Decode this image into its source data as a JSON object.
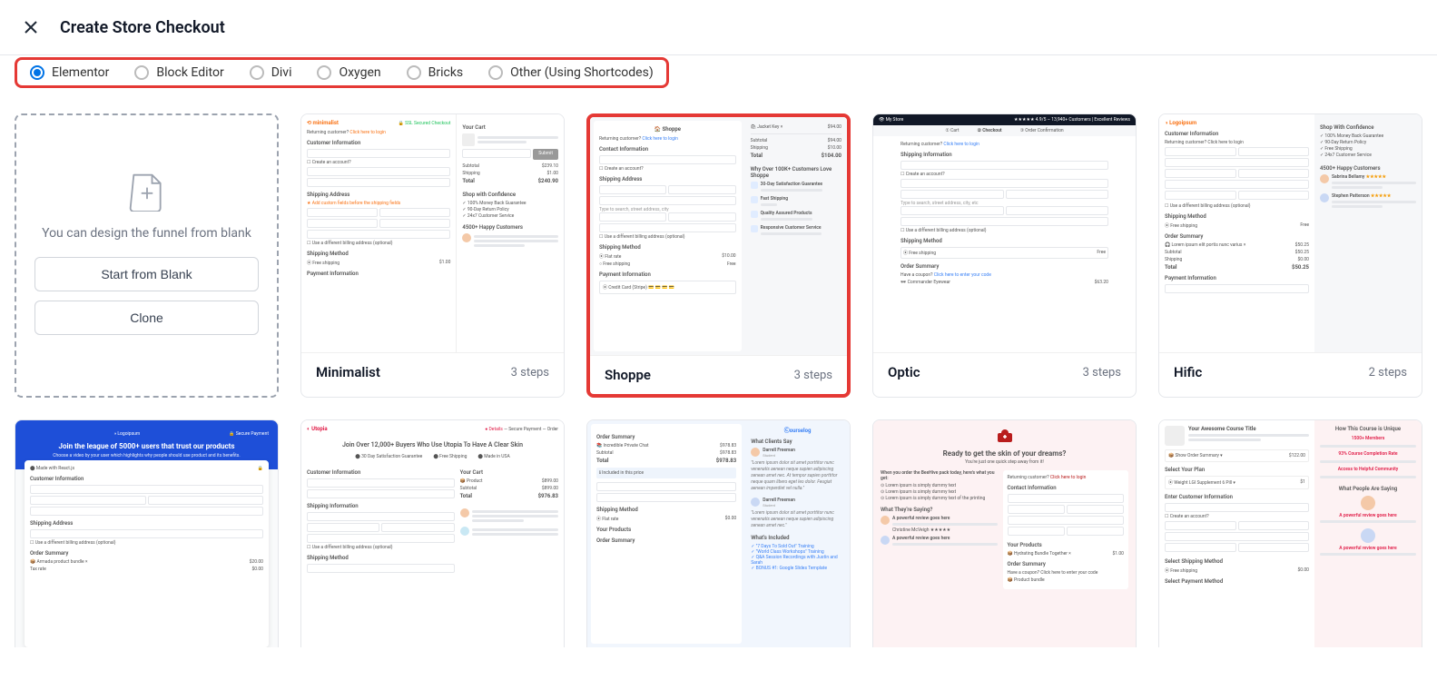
{
  "header": {
    "title": "Create Store Checkout"
  },
  "tabs": {
    "items": [
      {
        "label": "Elementor",
        "active": true
      },
      {
        "label": "Block Editor",
        "active": false
      },
      {
        "label": "Divi",
        "active": false
      },
      {
        "label": "Oxygen",
        "active": false
      },
      {
        "label": "Bricks",
        "active": false
      },
      {
        "label": "Other (Using Shortcodes)",
        "active": false
      }
    ]
  },
  "blank": {
    "text": "You can design the funnel from blank",
    "start": "Start from Blank",
    "clone": "Clone"
  },
  "templates": [
    {
      "name": "Minimalist",
      "steps": "3 steps",
      "highlighted": false
    },
    {
      "name": "Shoppe",
      "steps": "3 steps",
      "highlighted": true
    },
    {
      "name": "Optic",
      "steps": "3 steps",
      "highlighted": false
    },
    {
      "name": "Hific",
      "steps": "2 steps",
      "highlighted": false
    }
  ]
}
